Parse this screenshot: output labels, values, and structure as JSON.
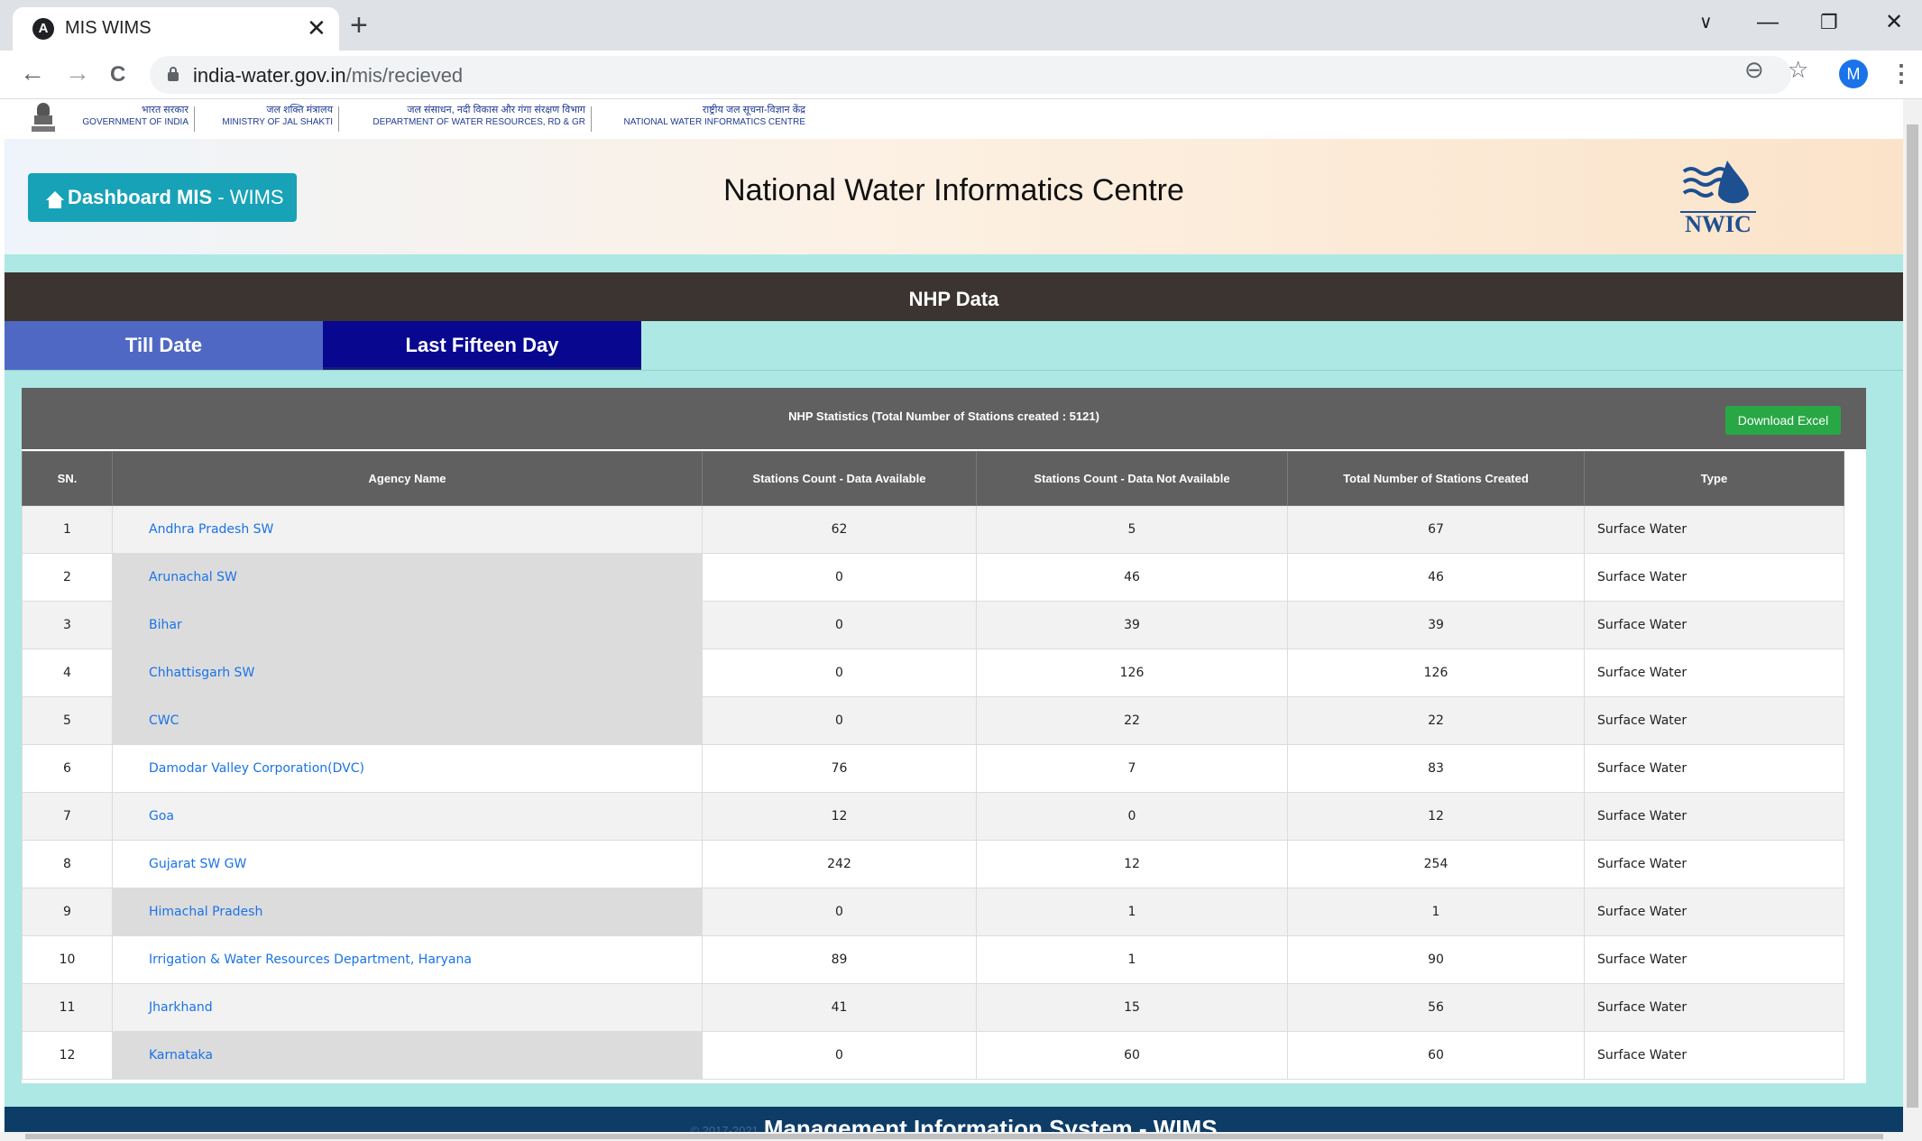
{
  "browser": {
    "tab_title": "MIS WIMS",
    "tab_close": "✕",
    "new_tab": "+",
    "url_host": "india-water.gov.in",
    "url_path": "/mis/recieved",
    "avatar_initial": "M",
    "icons": [
      "angular-favicon",
      "back-icon",
      "forward-icon",
      "reload-icon",
      "lock-icon",
      "zoom-icon",
      "star-icon",
      "menu-icon",
      "minimize-icon",
      "restore-icon",
      "close-icon"
    ],
    "controls": {
      "back": "←",
      "forward": "→",
      "reload": "C",
      "zoom": "⊖",
      "star": "☆",
      "menu": "⋮",
      "minimize": "—",
      "restore": "❐",
      "close": "✕",
      "dropdown": "∨"
    }
  },
  "gov_strip": [
    {
      "hindi": "भारत सरकार",
      "english": "GOVERNMENT OF INDIA"
    },
    {
      "hindi": "जल शक्ति मंत्रालय",
      "english": "MINISTRY OF JAL SHAKTI"
    },
    {
      "hindi": "जल संसाधन, नदी विकास और गंगा संरक्षण विभाग",
      "english": "DEPARTMENT OF WATER RESOURCES, RD & GR"
    },
    {
      "hindi": "राष्ट्रीय जल सूचना-विज्ञान केंद्र",
      "english": "NATIONAL WATER INFORMATICS CENTRE"
    }
  ],
  "header": {
    "dashboard_bold": "Dashboard MIS",
    "dashboard_rest": " - WIMS",
    "site_title": "National Water Informatics Centre",
    "logo_text": "NWIC"
  },
  "section": {
    "title": "NHP Data",
    "tabs": [
      "Till Date",
      "Last Fifteen Day"
    ],
    "active_tab": "Last Fifteen Day"
  },
  "stats": {
    "title": "NHP Statistics (Total Number of Stations created : 5121)",
    "download_label": "Download Excel"
  },
  "table": {
    "headers": [
      "SN.",
      "Agency Name",
      "Stations Count - Data Available",
      "Stations Count - Data Not Available",
      "Total Number of Stations Created",
      "Type"
    ],
    "rows": [
      {
        "sn": "1",
        "agency": "Andhra Pradesh SW",
        "available": "62",
        "not_available": "5",
        "total": "67",
        "type": "Surface Water"
      },
      {
        "sn": "2",
        "agency": "Arunachal SW",
        "available": "0",
        "not_available": "46",
        "total": "46",
        "type": "Surface Water"
      },
      {
        "sn": "3",
        "agency": "Bihar",
        "available": "0",
        "not_available": "39",
        "total": "39",
        "type": "Surface Water"
      },
      {
        "sn": "4",
        "agency": "Chhattisgarh SW",
        "available": "0",
        "not_available": "126",
        "total": "126",
        "type": "Surface Water"
      },
      {
        "sn": "5",
        "agency": "CWC",
        "available": "0",
        "not_available": "22",
        "total": "22",
        "type": "Surface Water"
      },
      {
        "sn": "6",
        "agency": "Damodar Valley Corporation(DVC)",
        "available": "76",
        "not_available": "7",
        "total": "83",
        "type": "Surface Water"
      },
      {
        "sn": "7",
        "agency": "Goa",
        "available": "12",
        "not_available": "0",
        "total": "12",
        "type": "Surface Water"
      },
      {
        "sn": "8",
        "agency": "Gujarat SW GW",
        "available": "242",
        "not_available": "12",
        "total": "254",
        "type": "Surface Water"
      },
      {
        "sn": "9",
        "agency": "Himachal Pradesh",
        "available": "0",
        "not_available": "1",
        "total": "1",
        "type": "Surface Water"
      },
      {
        "sn": "10",
        "agency": "Irrigation & Water Resources Department, Haryana",
        "available": "89",
        "not_available": "1",
        "total": "90",
        "type": "Surface Water"
      },
      {
        "sn": "11",
        "agency": "Jharkhand",
        "available": "41",
        "not_available": "15",
        "total": "56",
        "type": "Surface Water"
      },
      {
        "sn": "12",
        "agency": "Karnataka",
        "available": "0",
        "not_available": "60",
        "total": "60",
        "type": "Surface Water"
      }
    ]
  },
  "footer": {
    "copyright": "© 2017-2021",
    "title": "Management Information System - WIMS"
  },
  "colors": {
    "dashboard_button": "#17a2b8",
    "content_bg": "#ade8e4",
    "nhp_bar": "#3b3430",
    "tab_inactive": "#4f68c4",
    "tab_active": "#08078f",
    "table_header": "#606060",
    "download_button": "#28a745",
    "link": "#1a73e8",
    "footer": "#0d3c66"
  }
}
